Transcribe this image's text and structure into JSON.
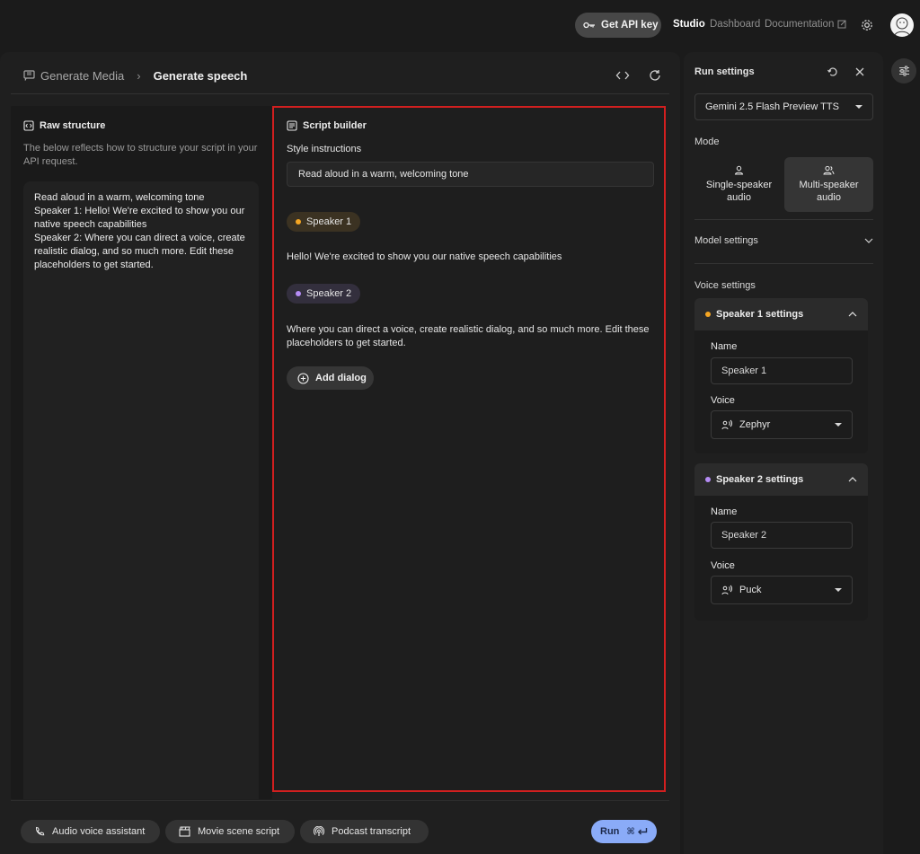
{
  "topbar": {
    "api_key_label": "Get API key",
    "nav": {
      "studio": "Studio",
      "dashboard": "Dashboard",
      "documentation": "Documentation"
    }
  },
  "breadcrumb": {
    "parent": "Generate Media",
    "current": "Generate speech"
  },
  "raw_structure": {
    "title": "Raw structure",
    "description": "The below reflects how to structure your script in your API request.",
    "content": "Read aloud in a warm, welcoming tone\nSpeaker 1: Hello! We're excited to show you our native speech capabilities\nSpeaker 2: Where you can direct a voice, create realistic dialog, and so much more. Edit these placeholders to get started."
  },
  "script_builder": {
    "title": "Script builder",
    "style_label": "Style instructions",
    "style_value": "Read aloud in a warm, welcoming tone",
    "speaker1": {
      "name": "Speaker 1",
      "text": "Hello! We're excited to show you our native speech capabilities"
    },
    "speaker2": {
      "name": "Speaker 2",
      "text": "Where you can direct a voice, create realistic dialog, and so much more. Edit these placeholders to get started."
    },
    "add_dialog": "Add dialog"
  },
  "footer": {
    "presets": [
      "Audio voice assistant",
      "Movie scene script",
      "Podcast transcript"
    ],
    "run_label": "Run",
    "run_shortcut": "⌘"
  },
  "run_settings": {
    "title": "Run settings",
    "model": "Gemini 2.5 Flash Preview TTS",
    "mode_label": "Mode",
    "mode_single": "Single-speaker audio",
    "mode_multi": "Multi-speaker audio",
    "model_settings": "Model settings",
    "voice_settings": "Voice settings",
    "speaker1": {
      "header": "Speaker 1 settings",
      "name_label": "Name",
      "name_value": "Speaker 1",
      "voice_label": "Voice",
      "voice_value": "Zephyr"
    },
    "speaker2": {
      "header": "Speaker 2 settings",
      "name_label": "Name",
      "name_value": "Speaker 2",
      "voice_label": "Voice",
      "voice_value": "Puck"
    }
  },
  "colors": {
    "speaker1_dot": "#f5a623",
    "speaker2_dot": "#b58cf5",
    "run_button": "#8aabf8",
    "highlight_border": "#d21f1f"
  },
  "icons": {
    "api_key": "key-icon",
    "external_link": "external-link-icon",
    "settings": "gear-icon",
    "breadcrumb": "media-icon",
    "code": "code-icon",
    "refresh": "refresh-icon",
    "raw": "brackets-doc-icon",
    "script": "script-doc-icon",
    "add": "add-circle-icon",
    "phone": "phone-icon",
    "movie": "clapperboard-icon",
    "podcast": "podcast-icon",
    "reset": "reset-icon",
    "close": "close-icon",
    "person": "person-icon",
    "people": "people-icon",
    "chevron": "chevron-icon",
    "voice": "voice-icon",
    "tune": "tune-icon"
  }
}
